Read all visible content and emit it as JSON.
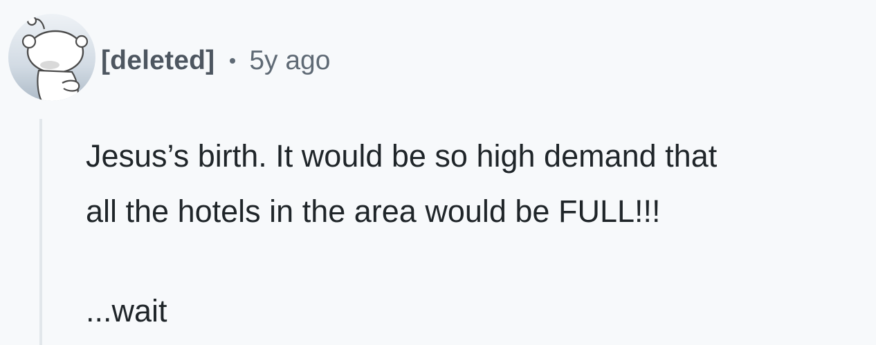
{
  "comment": {
    "author": "[deleted]",
    "separator": "•",
    "timestamp": "5y ago",
    "avatar_icon": "reddit-snoo-avatar-icon",
    "body": {
      "line1": "Jesus’s birth. It would be so high demand that",
      "line2": "all the hotels in the area would be FULL!!!",
      "line3": "...wait"
    }
  },
  "colors": {
    "background": "#f7f9fb",
    "author_text": "#4d5660",
    "meta_text": "#5f6a75",
    "body_text": "#1f2529",
    "thread_line": "#e2e7eb"
  }
}
